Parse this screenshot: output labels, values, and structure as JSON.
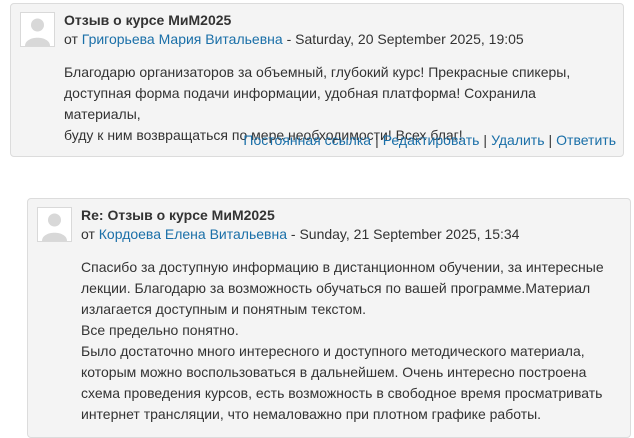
{
  "posts": [
    {
      "subject": "Отзыв о курсе МиМ2025",
      "by": "от",
      "author": "Григорьева Мария Витальевна",
      "date": " - Saturday, 20 September 2025, 19:05",
      "lines": [
        "Благодарю организаторов за объемный, глубокий курс! Прекрасные спикеры,",
        "доступная форма подачи информации, удобная платформа! Сохранила материалы,",
        "буду к ним возвращаться по мере необходимости! Всех благ!"
      ],
      "commands": [
        "Постоянная ссылка",
        "Редактировать",
        "Удалить",
        "Ответить"
      ],
      "separator": "|"
    },
    {
      "subject": "Re: Отзыв о курсе МиМ2025",
      "by": "от",
      "author": "Кордоева Елена Витальевна",
      "date": " - Sunday, 21 September 2025, 15:34",
      "lines": [
        "Спасибо за доступную информацию в дистанционном обучении, за интересные",
        "лекции. Благодарю за возможность обучаться по вашей программе.Материал",
        "излагается доступным и понятным текстом.",
        "Все предельно понятно.",
        "Было достаточно много интересного и доступного методического материала,",
        "которым можно воспользоваться в дальнейшем. Очень интересно построена",
        "схема проведения курсов, есть возможность в свободное время просматривать",
        "интернет трансляции, что немаловажно при плотном графике работы."
      ]
    }
  ],
  "colors": {
    "link": "#1a6fa8",
    "post_bg": "#f4f4f4",
    "border": "#dcdcdc"
  },
  "icons": {
    "avatar": "default-user-avatar-icon"
  }
}
